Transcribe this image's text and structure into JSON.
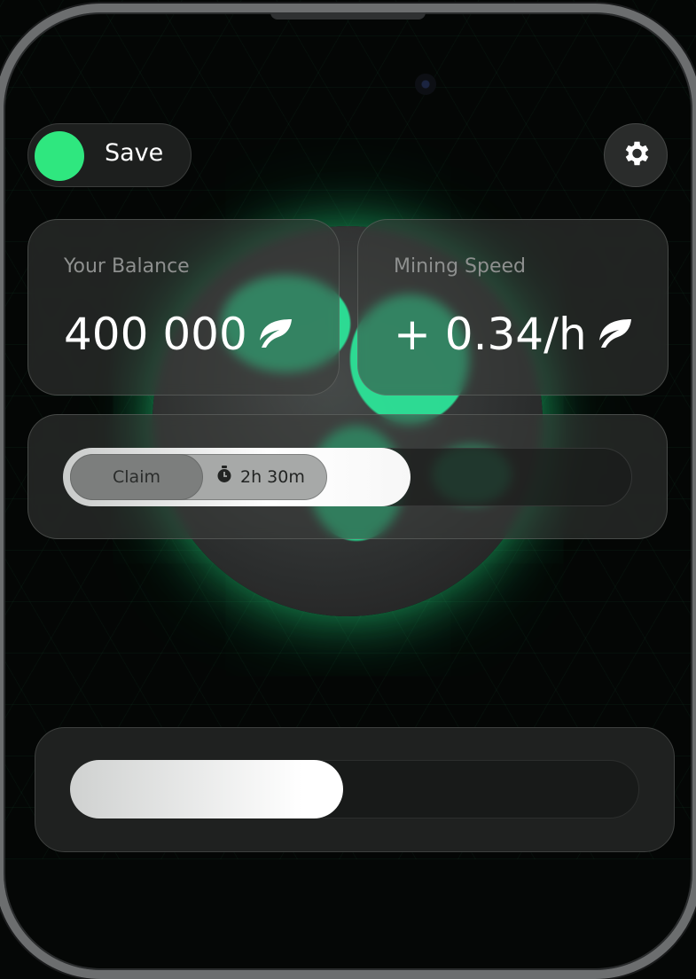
{
  "header": {
    "toggle_label": "Save",
    "toggle_state": "on",
    "toggle_color": "#2fe77f"
  },
  "settings": {
    "icon": "gear-icon"
  },
  "balance": {
    "label": "Your Balance",
    "value": "400 000",
    "currency_icon": "leaf-icon"
  },
  "mining": {
    "label": "Mining Speed",
    "value": "+ 0.34/h",
    "currency_icon": "leaf-icon"
  },
  "claim": {
    "button_label": "Claim",
    "timer_icon": "stopwatch-icon",
    "timer_value": "2h 30m",
    "progress_fraction": 0.61
  },
  "bottom": {
    "progress_fraction": 0.48
  },
  "colors": {
    "accent": "#2fe77f",
    "globe_glow": "#28ff96"
  }
}
